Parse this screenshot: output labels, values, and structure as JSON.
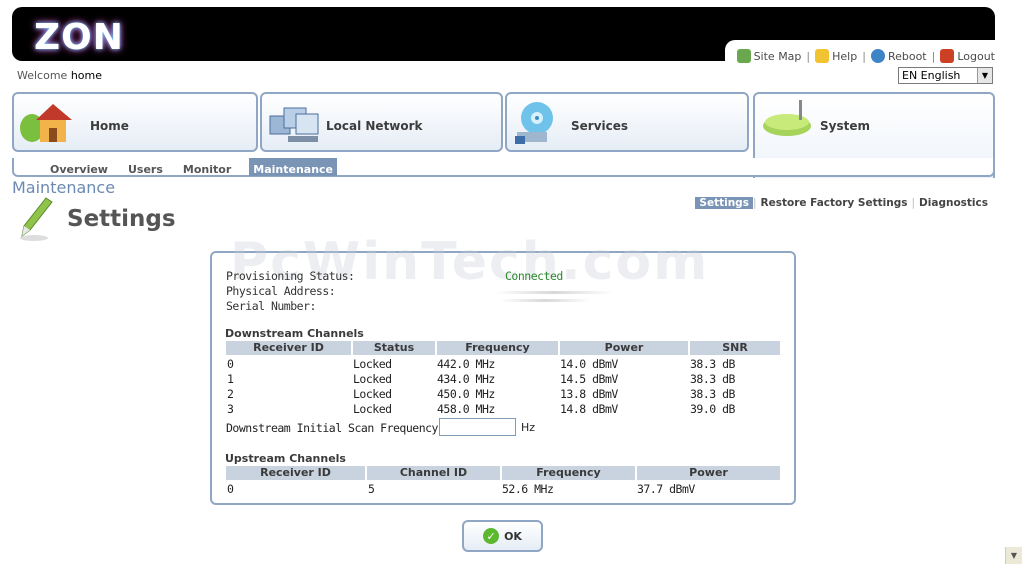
{
  "brand": {
    "logo": "ZON"
  },
  "toplinks": {
    "site_map": "Site Map",
    "help": "Help",
    "reboot": "Reboot",
    "logout": "Logout"
  },
  "welcome": {
    "prefix": "Welcome",
    "user": "home"
  },
  "language": {
    "selected": "EN English"
  },
  "tabs": [
    {
      "label": "Home",
      "icon": "house-icon"
    },
    {
      "label": "Local Network",
      "icon": "computers-icon"
    },
    {
      "label": "Services",
      "icon": "disc-icon"
    },
    {
      "label": "System",
      "icon": "router-icon"
    }
  ],
  "subnav": [
    "Overview",
    "Users",
    "Monitor",
    "Maintenance"
  ],
  "section": "Maintenance",
  "page_title": "Settings",
  "right_links": [
    "Settings",
    "Restore Factory Settings",
    "Diagnostics"
  ],
  "watermark": "PcWinTech.com",
  "info": {
    "provisioning_label": "Provisioning Status:",
    "provisioning_value": "Connected",
    "physical_label": "Physical Address:",
    "serial_label": "Serial Number:"
  },
  "downstream": {
    "title": "Downstream Channels",
    "headers": [
      "Receiver ID",
      "Status",
      "Frequency",
      "Power",
      "SNR"
    ],
    "rows": [
      [
        "0",
        "Locked",
        "442.0 MHz",
        "14.0 dBmV",
        "38.3 dB"
      ],
      [
        "1",
        "Locked",
        "434.0 MHz",
        "14.5 dBmV",
        "38.3 dB"
      ],
      [
        "2",
        "Locked",
        "450.0 MHz",
        "13.8 dBmV",
        "38.3 dB"
      ],
      [
        "3",
        "Locked",
        "458.0 MHz",
        "14.8 dBmV",
        "39.0 dB"
      ]
    ],
    "scan_label": "Downstream Initial Scan Frequency:",
    "scan_value": "",
    "scan_unit": "Hz"
  },
  "upstream": {
    "title": "Upstream Channels",
    "headers": [
      "Receiver ID",
      "Channel ID",
      "Frequency",
      "Power"
    ],
    "rows": [
      [
        "0",
        "5",
        "52.6 MHz",
        "37.7 dBmV"
      ]
    ]
  },
  "ok_label": "OK"
}
